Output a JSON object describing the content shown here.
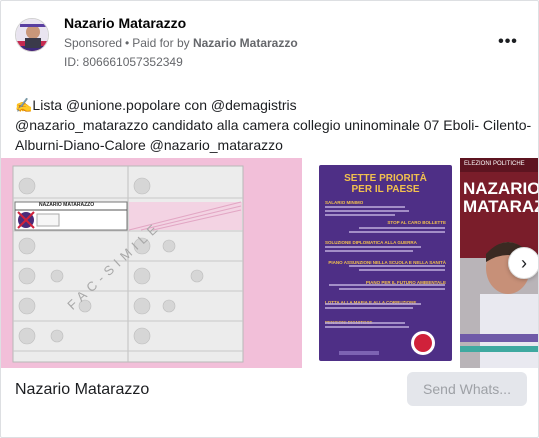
{
  "advertiser": {
    "name": "Nazario Matarazzo",
    "sponsored_label": "Sponsored",
    "paid_for_prefix": "Paid for by",
    "paid_for_name": "Nazario Matarazzo",
    "ad_id_text": "ID: 806661057352349"
  },
  "menu": {
    "more_glyph": "•••"
  },
  "body": {
    "line1": "✍️Lista @unione.popolare con @demagistris",
    "line2": "@nazario_matarazzo candidato alla camera collegio uninominale 07 Eboli- Cilento-",
    "line3": "Alburni-Diano-Calore @nazario_matarazzo"
  },
  "carousel": {
    "slide1": {
      "watermark": "FAC-SIMILE",
      "name_label": "NAZARIO MATARAZZO"
    },
    "slide2": {
      "heading1": "SETTE PRIORITÀ",
      "heading2": "PER IL PAESE",
      "items": [
        "SALARIO MINIMO",
        "STOP AL CARO BOLLETTE",
        "SOLUZIONE DIPLOMATICA ALLA GUERRA",
        "PIANO ASSUNZIONI NELLA SCUOLA E NELLA SANITÀ",
        "PIANO PER IL FUTURO AMBIENTALE",
        "LOTTA ALLA MAFIA E ALLA CORRUZIONE",
        "PENSIONI DIGNITOSE"
      ]
    },
    "slide3": {
      "top_label": "ELEZIONI POLITICHE",
      "name": "NAZARIO MATARAZZO"
    },
    "next_glyph": "›"
  },
  "footer": {
    "title": "Nazario Matarazzo",
    "cta_label": "Send Whats..."
  },
  "colors": {
    "pink_slide": "#f2bfd9",
    "purple_slide": "#4e2f86",
    "priority_yellow": "#f2c14e",
    "red_slide": "#7a1d2a"
  }
}
